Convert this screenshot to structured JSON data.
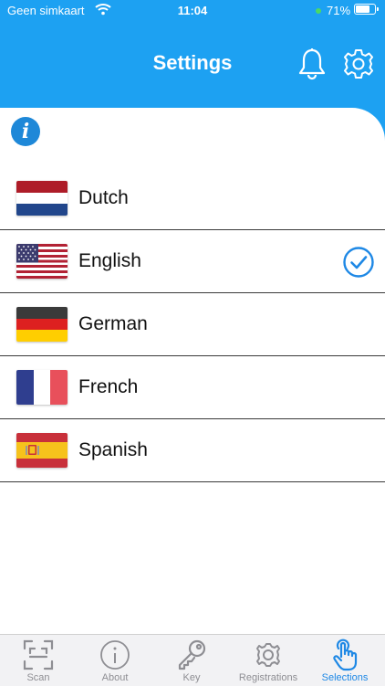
{
  "status_bar": {
    "carrier": "Geen simkaart",
    "time": "11:04",
    "battery": "71%"
  },
  "header": {
    "title": "Settings"
  },
  "languages": [
    {
      "label": "Dutch",
      "selected": false
    },
    {
      "label": "English",
      "selected": true
    },
    {
      "label": "German",
      "selected": false
    },
    {
      "label": "French",
      "selected": false
    },
    {
      "label": "Spanish",
      "selected": false
    }
  ],
  "tabs": [
    {
      "label": "Scan",
      "icon": "scan-icon",
      "active": false
    },
    {
      "label": "About",
      "icon": "info-icon",
      "active": false
    },
    {
      "label": "Key",
      "icon": "key-icon",
      "active": false
    },
    {
      "label": "Registrations",
      "icon": "registrations-icon",
      "active": false
    },
    {
      "label": "Selections",
      "icon": "tap-icon",
      "active": true
    }
  ],
  "colors": {
    "accent": "#1da1f2",
    "active_tab": "#1e88e5",
    "inactive_tab": "#8e8e93"
  }
}
